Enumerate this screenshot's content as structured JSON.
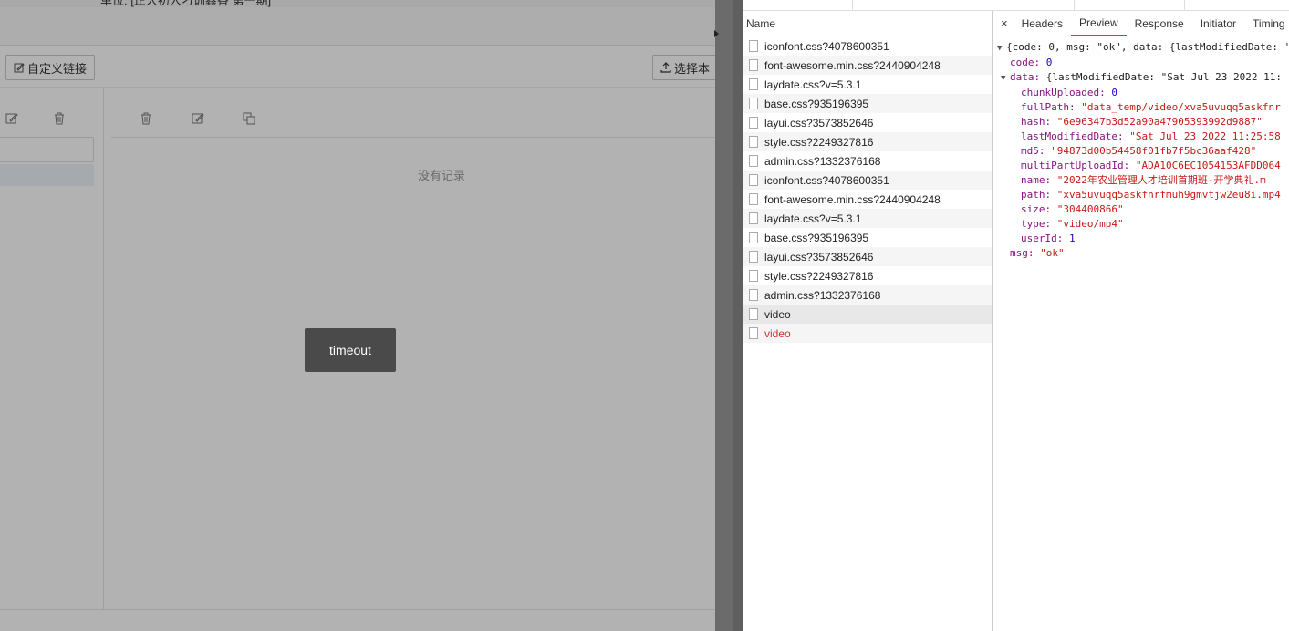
{
  "app": {
    "top_title_fragment": "单位: [正大初人刁训鑫香 第一期]",
    "custom_link_button": "自定义链接",
    "upload_button": "选择本",
    "empty_text": "没有记录",
    "toast": "timeout"
  },
  "devtools": {
    "name_header": "Name",
    "requests": [
      {
        "name": "iconfont.css?4078600351",
        "status": "ok"
      },
      {
        "name": "font-awesome.min.css?2440904248",
        "status": "ok"
      },
      {
        "name": "laydate.css?v=5.3.1",
        "status": "ok"
      },
      {
        "name": "base.css?935196395",
        "status": "ok"
      },
      {
        "name": "layui.css?3573852646",
        "status": "ok"
      },
      {
        "name": "style.css?2249327816",
        "status": "ok"
      },
      {
        "name": "admin.css?1332376168",
        "status": "ok"
      },
      {
        "name": "iconfont.css?4078600351",
        "status": "ok"
      },
      {
        "name": "font-awesome.min.css?2440904248",
        "status": "ok"
      },
      {
        "name": "laydate.css?v=5.3.1",
        "status": "ok"
      },
      {
        "name": "base.css?935196395",
        "status": "ok"
      },
      {
        "name": "layui.css?3573852646",
        "status": "ok"
      },
      {
        "name": "style.css?2249327816",
        "status": "ok"
      },
      {
        "name": "admin.css?1332376168",
        "status": "ok"
      },
      {
        "name": "video",
        "status": "selected"
      },
      {
        "name": "video",
        "status": "error"
      }
    ],
    "tabs": {
      "close": "×",
      "headers": "Headers",
      "preview": "Preview",
      "response": "Response",
      "initiator": "Initiator",
      "timing": "Timing"
    },
    "json_preview": {
      "summary": "{code: 0, msg: \"ok\", data: {lastModifiedDate: '",
      "code_key": "code:",
      "code_val": "0",
      "data_key": "data:",
      "data_summary": "{lastModifiedDate: \"Sat Jul 23 2022 11:",
      "fields": [
        {
          "key": "chunkUploaded:",
          "val": "0",
          "kind": "n"
        },
        {
          "key": "fullPath:",
          "val": "\"data_temp/video/xva5uvuqq5askfnr",
          "kind": "s"
        },
        {
          "key": "hash:",
          "val": "\"6e96347b3d52a90a47905393992d9887\"",
          "kind": "s"
        },
        {
          "key": "lastModifiedDate:",
          "val": "\"Sat Jul 23 2022 11:25:58",
          "kind": "s"
        },
        {
          "key": "md5:",
          "val": "\"94873d00b54458f01fb7f5bc36aaf428\"",
          "kind": "s"
        },
        {
          "key": "multiPartUploadId:",
          "val": "\"ADA10C6EC1054153AFDD064",
          "kind": "s"
        },
        {
          "key": "name:",
          "val": "\"2022年农业管理人才培训首期班-开学典礼.m",
          "kind": "s"
        },
        {
          "key": "path:",
          "val": "\"xva5uvuqq5askfnrfmuh9gmvtjw2eu8i.mp4",
          "kind": "s"
        },
        {
          "key": "size:",
          "val": "\"304400866\"",
          "kind": "s"
        },
        {
          "key": "type:",
          "val": "\"video/mp4\"",
          "kind": "s"
        },
        {
          "key": "userId:",
          "val": "1",
          "kind": "n"
        }
      ],
      "msg_key": "msg:",
      "msg_val": "\"ok\""
    }
  }
}
